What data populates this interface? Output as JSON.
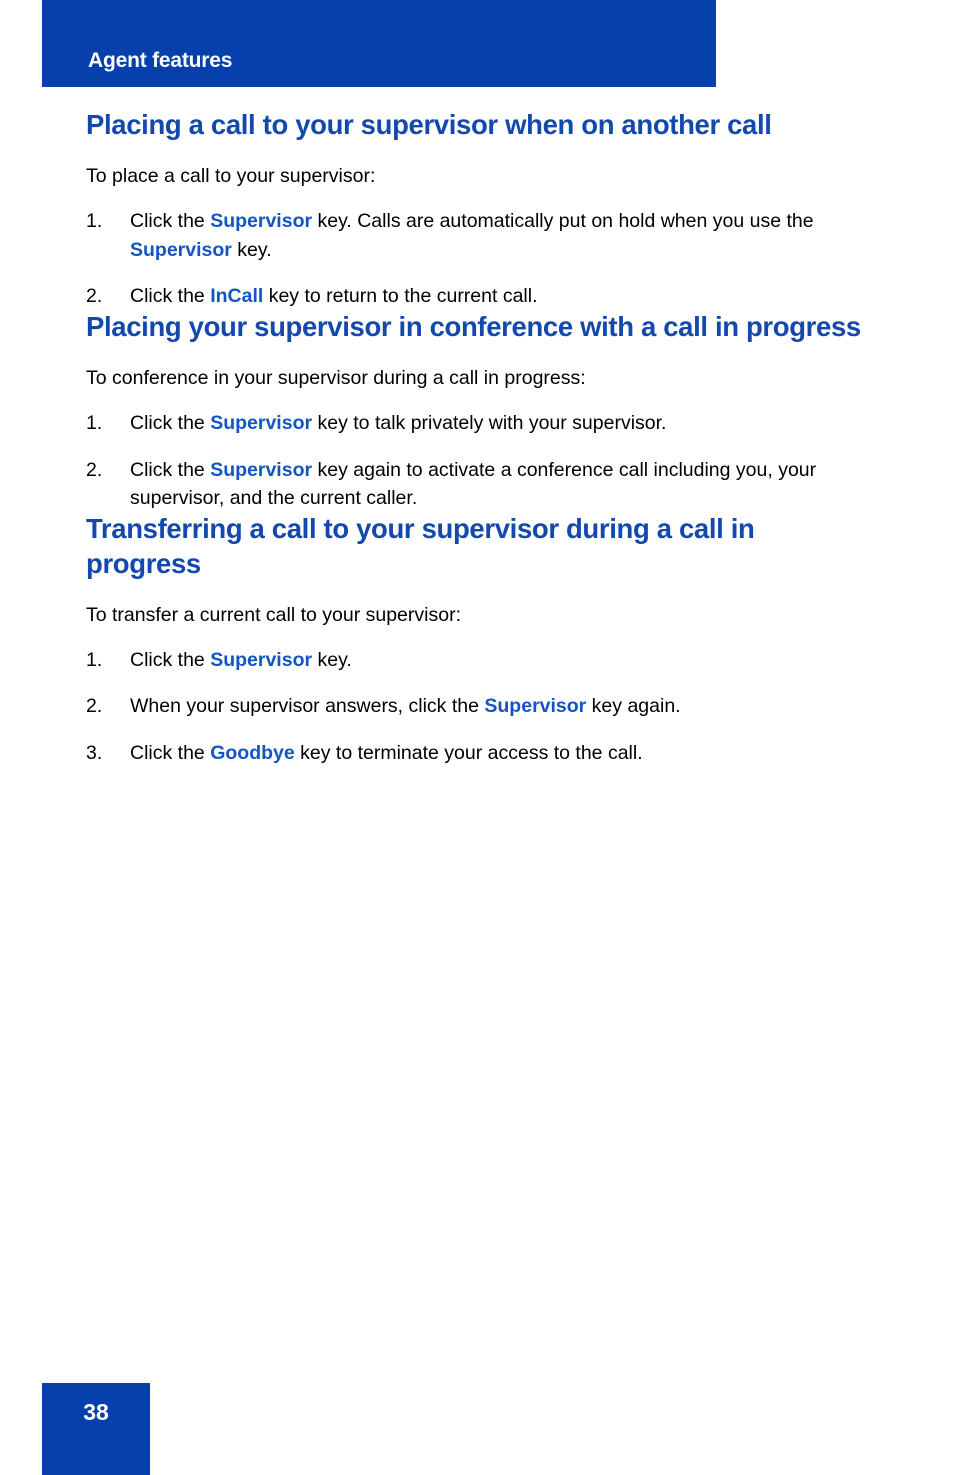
{
  "header": {
    "running_title": "Agent features",
    "band_color": "#0540AC"
  },
  "colors": {
    "brand_blue": "#0540AC",
    "heading_blue": "#1348AE",
    "key_blue": "#1255C4",
    "body_black": "#000000",
    "page_background": "#ffffff"
  },
  "sections": [
    {
      "heading": "Placing a call to your supervisor when on another call",
      "lead": "To place a call to your supervisor:",
      "steps": [
        {
          "number": "1.",
          "parts": [
            {
              "text": "Click the ",
              "style": "normal"
            },
            {
              "text": "Supervisor",
              "style": "key"
            },
            {
              "text": " key. Calls are automatically put on hold when you use the ",
              "style": "normal"
            },
            {
              "text": "Supervisor",
              "style": "key"
            },
            {
              "text": " key.",
              "style": "normal"
            }
          ]
        },
        {
          "number": "2.",
          "parts": [
            {
              "text": "Click the ",
              "style": "normal"
            },
            {
              "text": "InCall",
              "style": "key"
            },
            {
              "text": " key to return to the current call.",
              "style": "normal"
            }
          ]
        }
      ]
    },
    {
      "heading": "Placing your supervisor in conference with a call in progress",
      "lead": "To conference in your supervisor during a call in progress:",
      "steps": [
        {
          "number": "1.",
          "parts": [
            {
              "text": "Click the ",
              "style": "normal"
            },
            {
              "text": "Supervisor",
              "style": "key"
            },
            {
              "text": " key to talk privately with your supervisor.",
              "style": "normal"
            }
          ]
        },
        {
          "number": "2.",
          "parts": [
            {
              "text": "Click the ",
              "style": "normal"
            },
            {
              "text": "Supervisor",
              "style": "key"
            },
            {
              "text": " key again to activate a conference call including you, your supervisor, and the current caller.",
              "style": "normal"
            }
          ]
        }
      ]
    },
    {
      "heading": "Transferring a call to your supervisor during a call in progress",
      "lead": "To transfer a current call to your supervisor:",
      "steps": [
        {
          "number": "1.",
          "parts": [
            {
              "text": "Click the ",
              "style": "normal"
            },
            {
              "text": "Supervisor",
              "style": "key"
            },
            {
              "text": " key.",
              "style": "normal"
            }
          ]
        },
        {
          "number": "2.",
          "parts": [
            {
              "text": "When your supervisor answers, click the ",
              "style": "normal"
            },
            {
              "text": "Supervisor",
              "style": "key"
            },
            {
              "text": " key again.",
              "style": "normal"
            }
          ]
        },
        {
          "number": "3.",
          "parts": [
            {
              "text": "Click the ",
              "style": "normal"
            },
            {
              "text": "Goodbye",
              "style": "key"
            },
            {
              "text": " key to terminate your access to the call.",
              "style": "normal"
            }
          ]
        }
      ]
    }
  ],
  "footer": {
    "page_number": "38"
  }
}
